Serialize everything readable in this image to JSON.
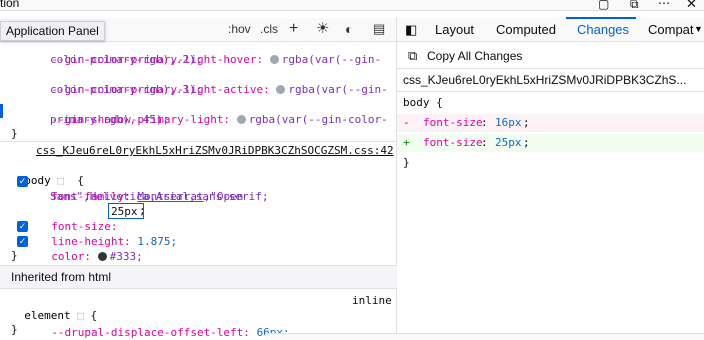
{
  "window": {
    "partial_title": "tion",
    "tooltip": "Application Panel"
  },
  "rules_toolbar": {
    "hov": ":hov",
    "cls": ".cls"
  },
  "right_tabs": [
    "Layout",
    "Computed",
    "Changes",
    "Compat"
  ],
  "active_tab": "Changes",
  "changes_panel": {
    "copy_all": "Copy All Changes",
    "source": "css_KJeu6reL0ryEkhL5xHriZSMv0JRiDPBK3CZhS...",
    "selector": "body {",
    "removed_prop": "font-size",
    "removed_val": "16px",
    "added_prop": "font-size",
    "added_val": "25px",
    "close": "}"
  },
  "rule1": {
    "l1a": "--gin-color-primary-light-hover:",
    "l1b": "rgba(var(--gin-",
    "l2": "color-primary-rgb),.2);",
    "l3a": "--gin-color-primary-light-active:",
    "l3b": "rgba(var(--gin-",
    "l4": "color-primary-rgb),.3);",
    "l5a": "--gin-shadow-primary-light:",
    "l5b": "rgba(var(--gin-color-",
    "l6": "primary-rgb),.45);",
    "close": "}"
  },
  "rule2": {
    "source": "css_KJeu6reL0ryEkhL5xHriZSMv0JRiDPBK3CZhSOCGZSM.css:42",
    "selector": "body",
    "open": "{",
    "ff_prop": "font-family:",
    "ff_val1": "Montserrat",
    "ff_val2": ",\"Open",
    "ff_val3": "Sans\",Helvetica,Arial,sans-serif;",
    "fs_prop": "font-size:",
    "fs_val": "25px",
    "lh_prop": "line-height:",
    "lh_val": "1.875;",
    "color_prop": "color:",
    "color_val": "#333;",
    "close": "}"
  },
  "inherited": "Inherited from html",
  "rule3": {
    "selector": "element",
    "open": "{",
    "inline": "inline",
    "prop": "--drupal-displace-offset-left:",
    "val": "66px;",
    "close": "}"
  },
  "colors": {
    "accent": "#0060df",
    "removed_bg": "#fdf2f5",
    "added_bg": "#f3fcf1",
    "color_swatch": "#333333",
    "gin_swatch": "#9fa7b3"
  }
}
